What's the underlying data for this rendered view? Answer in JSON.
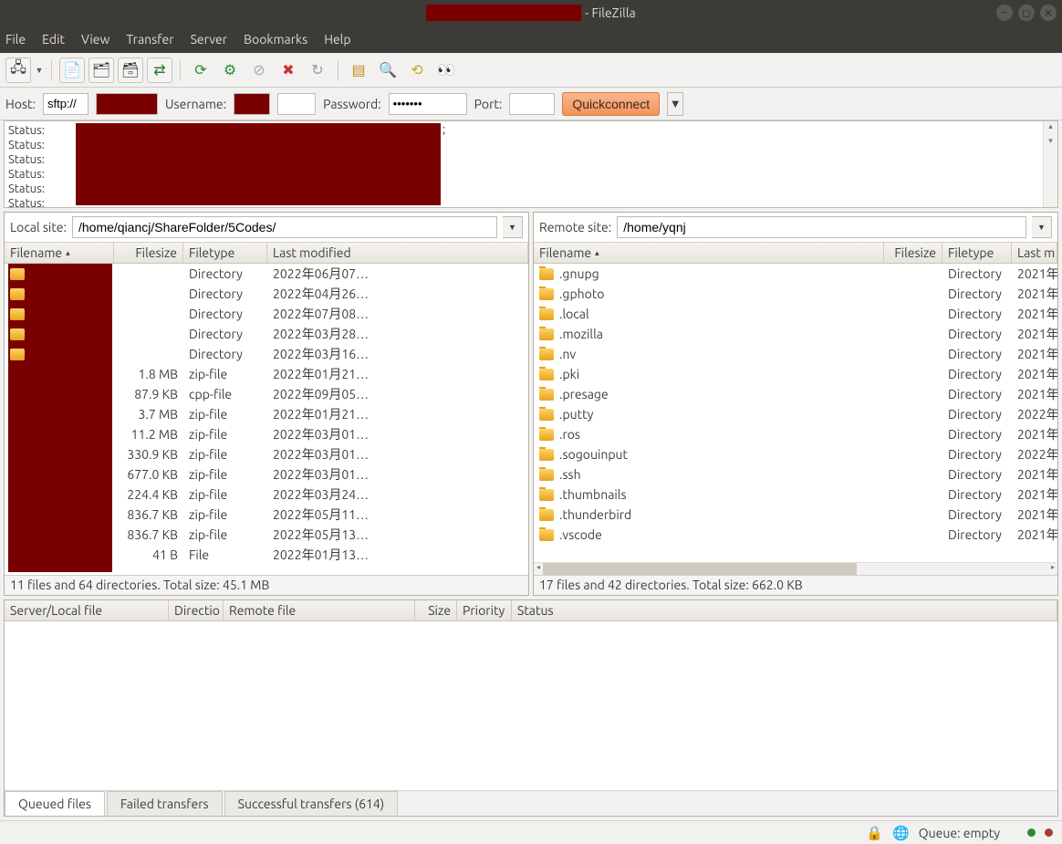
{
  "title_suffix": "- FileZilla",
  "menus": [
    "File",
    "Edit",
    "View",
    "Transfer",
    "Server",
    "Bookmarks",
    "Help"
  ],
  "toolbar_icons": [
    "site-manager-icon",
    "dropdown-icon",
    "|",
    "toggle-log-icon",
    "toggle-local-tree-icon",
    "toggle-remote-tree-icon",
    "toggle-queue-icon",
    "|",
    "refresh-icon",
    "process-queue-icon",
    "cancel-icon",
    "disconnect-icon",
    "reconnect-icon",
    "|",
    "filter-icon",
    "compare-icon",
    "sync-browse-icon",
    "search-icon"
  ],
  "quickconnect": {
    "host_label": "Host:",
    "host_value": "sftp://",
    "username_label": "Username:",
    "username_value": "",
    "password_label": "Password:",
    "password_value": "•••••••",
    "port_label": "Port:",
    "port_value": "",
    "button": "Quickconnect"
  },
  "log_labels": [
    "Status:",
    "Status:",
    "Status:",
    "Status:",
    "Status:",
    "Status:"
  ],
  "local": {
    "label": "Local site:",
    "path": "/home/qiancj/ShareFolder/5Codes/",
    "columns": [
      "Filename",
      "Filesize",
      "Filetype",
      "Last modified"
    ],
    "rows": [
      {
        "icon": "folder",
        "name": "",
        "size": "",
        "type": "Directory",
        "mod": "2022年06月07…"
      },
      {
        "icon": "folder",
        "name": "",
        "size": "",
        "type": "Directory",
        "mod": "2022年04月26…"
      },
      {
        "icon": "folder",
        "name": "",
        "size": "",
        "type": "Directory",
        "mod": "2022年07月08…"
      },
      {
        "icon": "folder",
        "name": "",
        "size": "",
        "type": "Directory",
        "mod": "2022年03月28…"
      },
      {
        "icon": "folder",
        "name": "",
        "size": "",
        "type": "Directory",
        "mod": "2022年03月16…"
      },
      {
        "icon": "file",
        "name": "",
        "size": "1.8 MB",
        "type": "zip-file",
        "mod": "2022年01月21…"
      },
      {
        "icon": "file",
        "name": "",
        "size": "87.9 KB",
        "type": "cpp-file",
        "mod": "2022年09月05…"
      },
      {
        "icon": "file",
        "name": "",
        "size": "3.7 MB",
        "type": "zip-file",
        "mod": "2022年01月21…"
      },
      {
        "icon": "file",
        "name": "",
        "size": "11.2 MB",
        "type": "zip-file",
        "mod": "2022年03月01…"
      },
      {
        "icon": "file",
        "name": "",
        "size": "330.9 KB",
        "type": "zip-file",
        "mod": "2022年03月01…"
      },
      {
        "icon": "file",
        "name": "",
        "size": "677.0 KB",
        "type": "zip-file",
        "mod": "2022年03月01…"
      },
      {
        "icon": "file",
        "name": "",
        "size": "224.4 KB",
        "type": "zip-file",
        "mod": "2022年03月24…"
      },
      {
        "icon": "file",
        "name": "",
        "size": "836.7 KB",
        "type": "zip-file",
        "mod": "2022年05月11…"
      },
      {
        "icon": "file",
        "name": "",
        "size": "836.7 KB",
        "type": "zip-file",
        "mod": "2022年05月13…"
      },
      {
        "icon": "file",
        "name": "",
        "size": "41 B",
        "type": "File",
        "mod": "2022年01月13…"
      }
    ],
    "summary": "11 files and 64 directories. Total size: 45.1 MB"
  },
  "remote": {
    "label": "Remote site:",
    "path": "/home/yqnj",
    "columns": [
      "Filename",
      "Filesize",
      "Filetype",
      "Last m"
    ],
    "rows": [
      {
        "name": ".gnupg",
        "type": "Directory",
        "mod": "2021年"
      },
      {
        "name": ".gphoto",
        "type": "Directory",
        "mod": "2021年"
      },
      {
        "name": ".local",
        "type": "Directory",
        "mod": "2021年"
      },
      {
        "name": ".mozilla",
        "type": "Directory",
        "mod": "2021年"
      },
      {
        "name": ".nv",
        "type": "Directory",
        "mod": "2021年"
      },
      {
        "name": ".pki",
        "type": "Directory",
        "mod": "2021年"
      },
      {
        "name": ".presage",
        "type": "Directory",
        "mod": "2021年"
      },
      {
        "name": ".putty",
        "type": "Directory",
        "mod": "2022年"
      },
      {
        "name": ".ros",
        "type": "Directory",
        "mod": "2021年"
      },
      {
        "name": ".sogouinput",
        "type": "Directory",
        "mod": "2022年"
      },
      {
        "name": ".ssh",
        "type": "Directory",
        "mod": "2021年"
      },
      {
        "name": ".thumbnails",
        "type": "Directory",
        "mod": "2021年"
      },
      {
        "name": ".thunderbird",
        "type": "Directory",
        "mod": "2021年"
      },
      {
        "name": ".vscode",
        "type": "Directory",
        "mod": "2021年"
      }
    ],
    "summary": "17 files and 42 directories. Total size: 662.0 KB"
  },
  "queue": {
    "columns": [
      "Server/Local file",
      "Directio",
      "Remote file",
      "Size",
      "Priority",
      "Status"
    ],
    "tabs": [
      "Queued files",
      "Failed transfers",
      "Successful transfers (614)"
    ],
    "active_tab": 0
  },
  "statusbar": {
    "queue_text": "Queue: empty"
  }
}
